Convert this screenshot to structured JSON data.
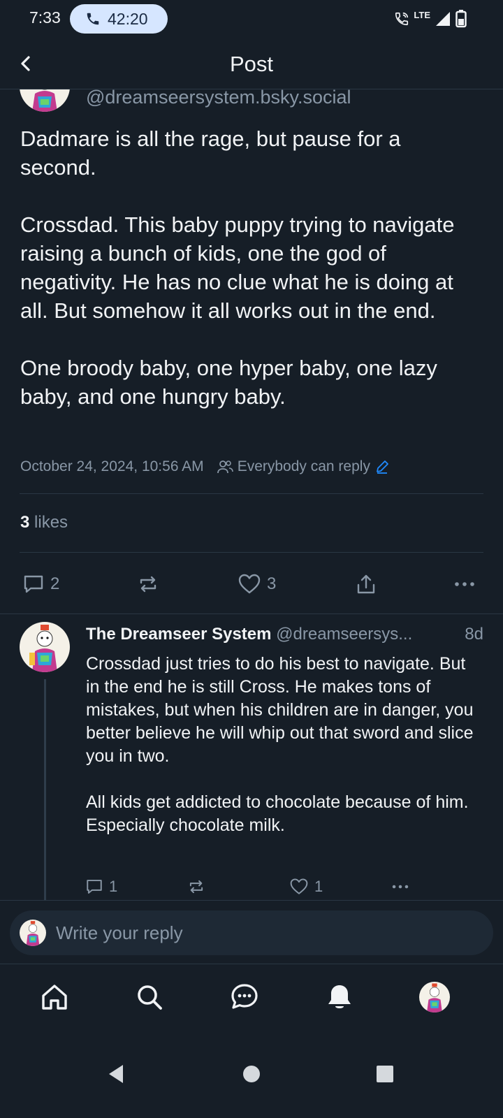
{
  "status_bar": {
    "time": "7:33",
    "call_timer": "42:20",
    "network": "LTE"
  },
  "header": {
    "title": "Post",
    "back_icon": "chevron-left-icon"
  },
  "post": {
    "handle": "@dreamseersystem.bsky.social",
    "body": "Dadmare is all the rage, but pause for a second.\n\nCrossdad. This baby puppy trying to navigate raising a bunch of kids, one the god of negativity. He has no clue what he is doing at all. But somehow it all works out in the end.\n\nOne broody baby, one hyper baby, one lazy baby, and one hungry baby.",
    "timestamp": "October 24, 2024, 10:56 AM",
    "reply_setting": "Everybody can reply",
    "likes_count": "3",
    "likes_label": "likes",
    "actions": {
      "replies": "2",
      "likes": "3"
    }
  },
  "reply": {
    "display_name": "The Dreamseer System",
    "handle": "@dreamseersys...",
    "age": "8d",
    "body": "Crossdad just tries to do his best to navigate. But in the end he is still Cross. He makes tons of mistakes, but when his children are in danger, you better believe he will whip out that sword and slice you in two.\n\nAll kids get addicted to chocolate because of him. Especially chocolate milk.",
    "actions": {
      "replies": "1",
      "likes": "1"
    }
  },
  "composer": {
    "placeholder": "Write your reply"
  },
  "colors": {
    "background": "#161e27",
    "text": "#f1f3f5",
    "muted": "#8997a6",
    "accent": "#208bfe",
    "call_pill": "#d6e6ff"
  }
}
